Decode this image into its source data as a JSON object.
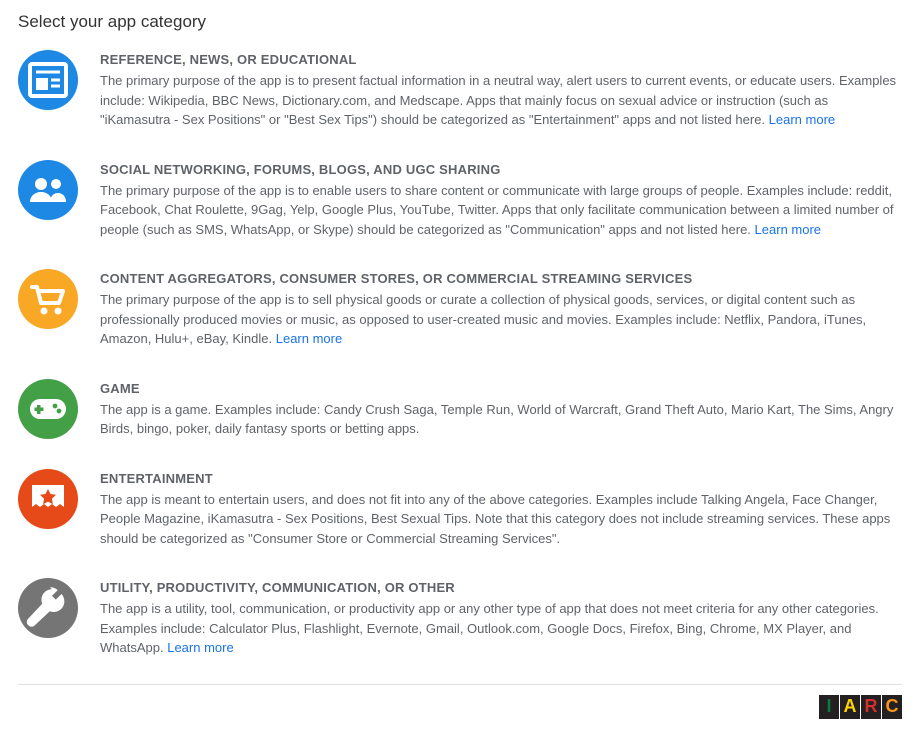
{
  "page_title": "Select your app category",
  "learn_more_label": "Learn more",
  "categories": [
    {
      "icon": "reference",
      "icon_bg": "#1e88e5",
      "title": "REFERENCE, NEWS, OR EDUCATIONAL",
      "desc": "The primary purpose of the app is to present factual information in a neutral way, alert users to current events, or educate users. Examples include: Wikipedia, BBC News, Dictionary.com, and Medscape. Apps that mainly focus on sexual advice or instruction (such as \"iKamasutra - Sex Positions\" or \"Best Sex Tips\") should be categorized as \"Entertainment\" apps and not listed here.",
      "learn_more": true
    },
    {
      "icon": "social",
      "icon_bg": "#1e88e5",
      "title": "SOCIAL NETWORKING, FORUMS, BLOGS, AND UGC SHARING",
      "desc": "The primary purpose of the app is to enable users to share content or communicate with large groups of people. Examples include: reddit, Facebook, Chat Roulette, 9Gag, Yelp, Google Plus, YouTube, Twitter. Apps that only facilitate communication between a limited number of people (such as SMS, WhatsApp, or Skype) should be categorized as \"Communication\" apps and not listed here.",
      "learn_more": true
    },
    {
      "icon": "cart",
      "icon_bg": "#f9a825",
      "title": "CONTENT AGGREGATORS, CONSUMER STORES, OR COMMERCIAL STREAMING SERVICES",
      "desc": "The primary purpose of the app is to sell physical goods or curate a collection of physical goods, services, or digital content such as professionally produced movies or music, as opposed to user-created music and movies. Examples include: Netflix, Pandora, iTunes, Amazon, Hulu+, eBay, Kindle.",
      "learn_more": true
    },
    {
      "icon": "game",
      "icon_bg": "#43a047",
      "title": "GAME",
      "desc": "The app is a game. Examples include: Candy Crush Saga, Temple Run, World of Warcraft, Grand Theft Auto, Mario Kart, The Sims, Angry Birds, bingo, poker, daily fantasy sports or betting apps.",
      "learn_more": false
    },
    {
      "icon": "entertainment",
      "icon_bg": "#e64a19",
      "title": "ENTERTAINMENT",
      "desc": "The app is meant to entertain users, and does not fit into any of the above categories. Examples include Talking Angela, Face Changer, People Magazine, iKamasutra - Sex Positions, Best Sexual Tips. Note that this category does not include streaming services. These apps should be categorized as \"Consumer Store or Commercial Streaming Services\".",
      "learn_more": false
    },
    {
      "icon": "utility",
      "icon_bg": "#757575",
      "title": "UTILITY, PRODUCTIVITY, COMMUNICATION, OR OTHER",
      "desc": "The app is a utility, tool, communication, or productivity app or any other type of app that does not meet criteria for any other categories. Examples include: Calculator Plus, Flashlight, Evernote, Gmail, Outlook.com, Google Docs, Firefox, Bing, Chrome, MX Player, and WhatsApp.",
      "learn_more": true
    }
  ],
  "iarc": {
    "letters": [
      "I",
      "A",
      "R",
      "C"
    ],
    "colors": [
      "#0d7a3c",
      "#ffd200",
      "#d22f2f",
      "#f7931e"
    ]
  }
}
